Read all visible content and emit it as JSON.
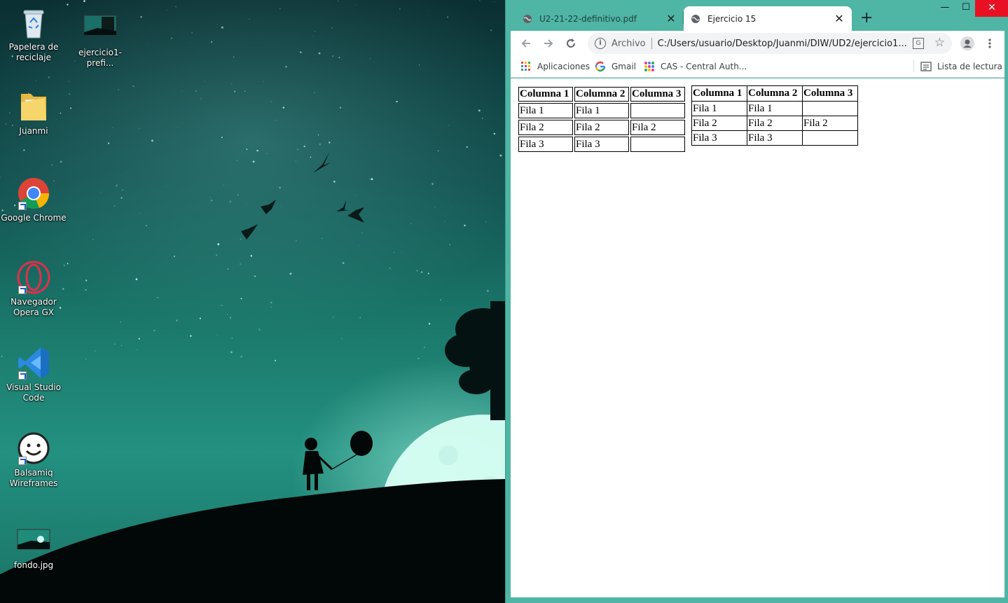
{
  "desktop": {
    "icons": [
      {
        "label": "Papelera de\nreciclaje",
        "icon": "recycle-bin-icon"
      },
      {
        "label": "ejercicio1-prefi...",
        "icon": "image-file-icon"
      },
      {
        "label": "Juanmi",
        "icon": "folder-icon"
      },
      {
        "label": "Google Chrome",
        "icon": "chrome-icon"
      },
      {
        "label": "Navegador\nOpera GX",
        "icon": "opera-gx-icon"
      },
      {
        "label": "Visual Studio\nCode",
        "icon": "vscode-icon"
      },
      {
        "label": "Balsamiq\nWireframes",
        "icon": "balsamiq-icon"
      },
      {
        "label": "fondo.jpg",
        "icon": "image-file-icon"
      }
    ]
  },
  "browser": {
    "tabs": [
      {
        "title": "U2-21-22-definitivo.pdf",
        "active": false
      },
      {
        "title": "Ejercicio 15",
        "active": true
      }
    ],
    "new_tab": "+",
    "close_glyph": "✕",
    "window": {
      "minimize": "—",
      "maximize": "☐",
      "close": "✕"
    },
    "omnibox": {
      "scheme": "Archivo",
      "url": "C:/Users/usuario/Desktop/Juanmi/DIW/UD2/ejercicio1..."
    },
    "bookmarks": {
      "items": [
        {
          "label": "Aplicaciones",
          "icon": "apps-grid-icon"
        },
        {
          "label": "Gmail",
          "icon": "google-icon"
        },
        {
          "label": "CAS - Central Auth...",
          "icon": "cas-icon"
        }
      ],
      "reading_list": "Lista de lectura"
    },
    "accent_color": "#4fb5a5"
  },
  "page": {
    "table_a": {
      "headers": [
        "Columna 1",
        "Columna 2",
        "Columna 3"
      ],
      "rows": [
        [
          "Fila 1",
          "Fila 1",
          ""
        ],
        [
          "Fila 2",
          "Fila 2",
          "Fila 2"
        ],
        [
          "Fila 3",
          "Fila 3",
          ""
        ]
      ]
    },
    "table_b": {
      "headers": [
        "Columna 1",
        "Columna 2",
        "Columna 3"
      ],
      "rows": [
        [
          "Fila 1",
          "Fila 1",
          ""
        ],
        [
          "Fila 2",
          "Fila 2",
          "Fila 2"
        ],
        [
          "Fila 3",
          "Fila 3",
          ""
        ]
      ]
    }
  }
}
